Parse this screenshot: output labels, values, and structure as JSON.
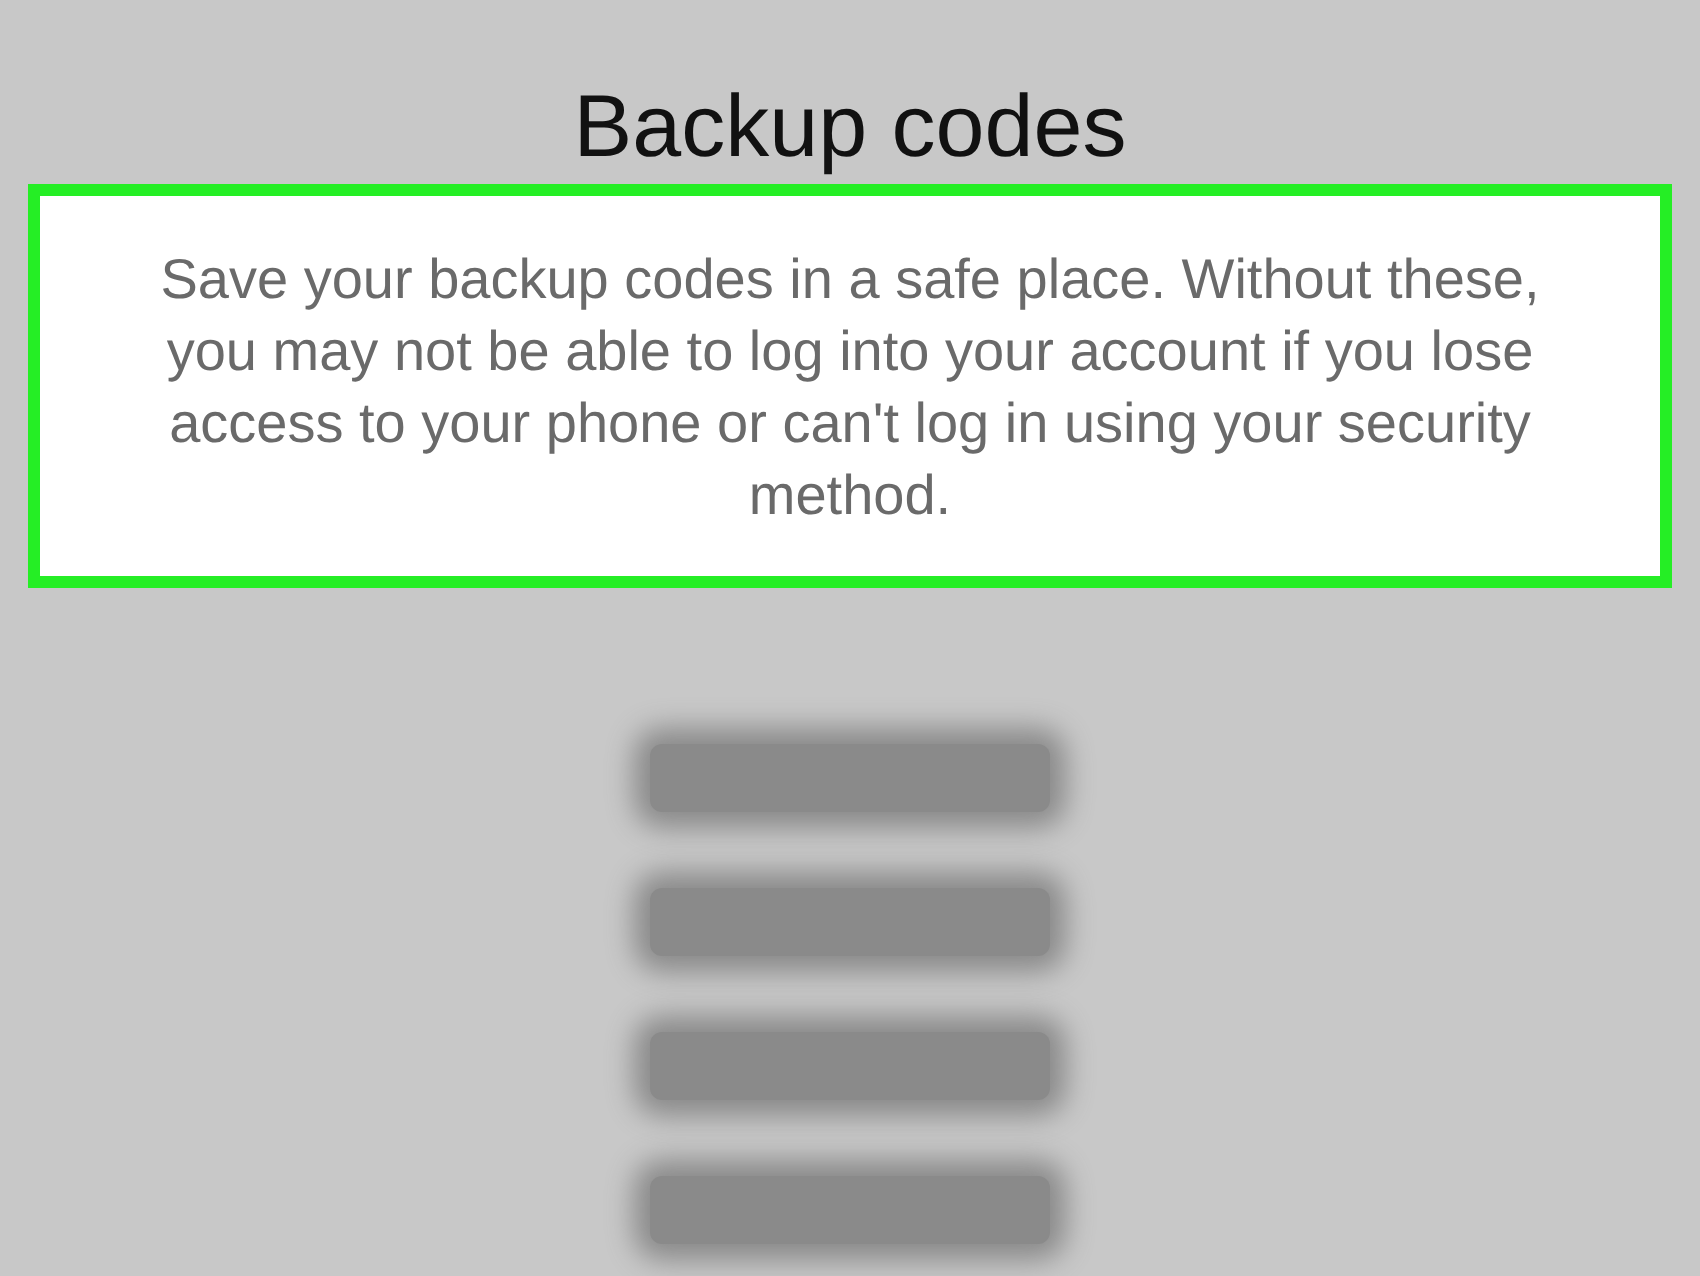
{
  "title": "Backup codes",
  "description": {
    "text": "Save your backup codes in a safe place. Without these, you may not be able to log into your account if you lose access to your phone or can't log in using your security method.",
    "highlighted": true
  },
  "codes": [
    {
      "blurred": true
    },
    {
      "blurred": true
    },
    {
      "blurred": true
    },
    {
      "blurred": true
    }
  ]
}
